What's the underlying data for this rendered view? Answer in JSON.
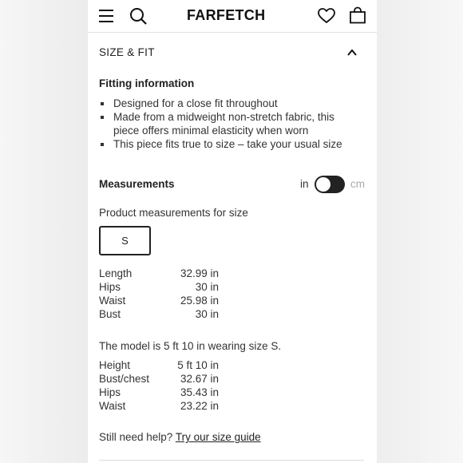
{
  "header": {
    "logo": "FARFETCH",
    "icons": [
      "menu-icon",
      "search-icon",
      "heart-icon",
      "bag-icon"
    ]
  },
  "section": {
    "title": "SIZE & FIT",
    "toggle_icon": "chevron-up-icon"
  },
  "fitting": {
    "heading": "Fitting information",
    "items": [
      "Designed for a close fit throughout",
      "Made from a midweight non-stretch fabric, this piece offers minimal elasticity when worn",
      "This piece fits true to size – take your usual size"
    ]
  },
  "measurements": {
    "heading": "Measurements",
    "unit_left": "in",
    "unit_right": "cm",
    "selected_unit": "in",
    "product_label": "Product measurements for size",
    "size": "S",
    "rows": [
      {
        "label": "Length",
        "value": "32.99 in"
      },
      {
        "label": "Hips",
        "value": "30 in"
      },
      {
        "label": "Waist",
        "value": "25.98 in"
      },
      {
        "label": "Bust",
        "value": "30 in"
      }
    ]
  },
  "model": {
    "text": "The model is 5 ft 10 in wearing size S.",
    "rows": [
      {
        "label": "Height",
        "value": "5 ft 10 in"
      },
      {
        "label": "Bust/chest",
        "value": "32.67 in"
      },
      {
        "label": "Hips",
        "value": "35.43 in"
      },
      {
        "label": "Waist",
        "value": "23.22 in"
      }
    ]
  },
  "help": {
    "text": "Still need help?",
    "link": "Try our size guide"
  },
  "colors": {
    "text": "#222222",
    "muted": "#aaaaaa",
    "toggle": "#222222",
    "background": "#ffffff"
  }
}
